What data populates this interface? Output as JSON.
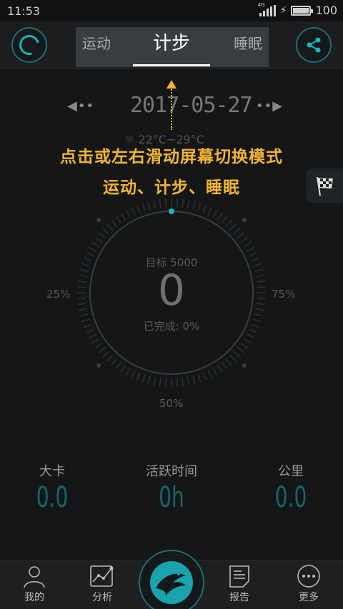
{
  "status": {
    "time": "11:53",
    "network": "4G",
    "battery": "100"
  },
  "header": {
    "tabs": [
      {
        "label": "运动"
      },
      {
        "label": "计步"
      },
      {
        "label": "睡眠"
      }
    ],
    "active_tab": 1
  },
  "date": {
    "value": "2017-05-27",
    "prev_icon": "chevron-left-icon",
    "next_icon": "chevron-right-icon"
  },
  "weather": {
    "text": "22°C~29°C",
    "icon": "sun-icon"
  },
  "guide": {
    "line1": "点击或左右滑动屏幕切换模式",
    "line2": "运动、计步、睡眠",
    "color": "#f2b533"
  },
  "dial": {
    "goal_text": "目标 5000",
    "steps": "0",
    "completed_text": "已完成: 0%",
    "progress": 0,
    "marks": {
      "p25": "25%",
      "p50": "50%",
      "p75": "75%"
    }
  },
  "stats": [
    {
      "label": "大卡",
      "value": "0.0"
    },
    {
      "label": "活跃时间",
      "value": "0h"
    },
    {
      "label": "公里",
      "value": "0.0"
    }
  ],
  "nav": {
    "items": [
      {
        "label": "我的",
        "icon": "person-icon"
      },
      {
        "label": "分析",
        "icon": "chart-icon"
      },
      {
        "label": "报告",
        "icon": "document-icon"
      },
      {
        "label": "更多",
        "icon": "more-icon"
      }
    ]
  },
  "colors": {
    "accent": "#1ab5bf",
    "background": "#141617",
    "highlight": "#f2b533"
  }
}
